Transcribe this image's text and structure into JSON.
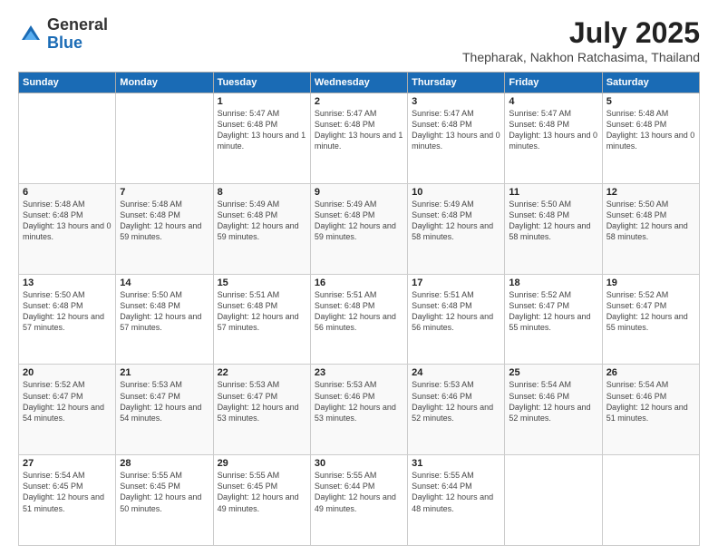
{
  "header": {
    "logo": {
      "general": "General",
      "blue": "Blue"
    },
    "title": "July 2025",
    "subtitle": "Thepharak, Nakhon Ratchasima, Thailand"
  },
  "days_of_week": [
    "Sunday",
    "Monday",
    "Tuesday",
    "Wednesday",
    "Thursday",
    "Friday",
    "Saturday"
  ],
  "weeks": [
    [
      {
        "day": "",
        "info": ""
      },
      {
        "day": "",
        "info": ""
      },
      {
        "day": "1",
        "info": "Sunrise: 5:47 AM\nSunset: 6:48 PM\nDaylight: 13 hours and 1 minute."
      },
      {
        "day": "2",
        "info": "Sunrise: 5:47 AM\nSunset: 6:48 PM\nDaylight: 13 hours and 1 minute."
      },
      {
        "day": "3",
        "info": "Sunrise: 5:47 AM\nSunset: 6:48 PM\nDaylight: 13 hours and 0 minutes."
      },
      {
        "day": "4",
        "info": "Sunrise: 5:47 AM\nSunset: 6:48 PM\nDaylight: 13 hours and 0 minutes."
      },
      {
        "day": "5",
        "info": "Sunrise: 5:48 AM\nSunset: 6:48 PM\nDaylight: 13 hours and 0 minutes."
      }
    ],
    [
      {
        "day": "6",
        "info": "Sunrise: 5:48 AM\nSunset: 6:48 PM\nDaylight: 13 hours and 0 minutes."
      },
      {
        "day": "7",
        "info": "Sunrise: 5:48 AM\nSunset: 6:48 PM\nDaylight: 12 hours and 59 minutes."
      },
      {
        "day": "8",
        "info": "Sunrise: 5:49 AM\nSunset: 6:48 PM\nDaylight: 12 hours and 59 minutes."
      },
      {
        "day": "9",
        "info": "Sunrise: 5:49 AM\nSunset: 6:48 PM\nDaylight: 12 hours and 59 minutes."
      },
      {
        "day": "10",
        "info": "Sunrise: 5:49 AM\nSunset: 6:48 PM\nDaylight: 12 hours and 58 minutes."
      },
      {
        "day": "11",
        "info": "Sunrise: 5:50 AM\nSunset: 6:48 PM\nDaylight: 12 hours and 58 minutes."
      },
      {
        "day": "12",
        "info": "Sunrise: 5:50 AM\nSunset: 6:48 PM\nDaylight: 12 hours and 58 minutes."
      }
    ],
    [
      {
        "day": "13",
        "info": "Sunrise: 5:50 AM\nSunset: 6:48 PM\nDaylight: 12 hours and 57 minutes."
      },
      {
        "day": "14",
        "info": "Sunrise: 5:50 AM\nSunset: 6:48 PM\nDaylight: 12 hours and 57 minutes."
      },
      {
        "day": "15",
        "info": "Sunrise: 5:51 AM\nSunset: 6:48 PM\nDaylight: 12 hours and 57 minutes."
      },
      {
        "day": "16",
        "info": "Sunrise: 5:51 AM\nSunset: 6:48 PM\nDaylight: 12 hours and 56 minutes."
      },
      {
        "day": "17",
        "info": "Sunrise: 5:51 AM\nSunset: 6:48 PM\nDaylight: 12 hours and 56 minutes."
      },
      {
        "day": "18",
        "info": "Sunrise: 5:52 AM\nSunset: 6:47 PM\nDaylight: 12 hours and 55 minutes."
      },
      {
        "day": "19",
        "info": "Sunrise: 5:52 AM\nSunset: 6:47 PM\nDaylight: 12 hours and 55 minutes."
      }
    ],
    [
      {
        "day": "20",
        "info": "Sunrise: 5:52 AM\nSunset: 6:47 PM\nDaylight: 12 hours and 54 minutes."
      },
      {
        "day": "21",
        "info": "Sunrise: 5:53 AM\nSunset: 6:47 PM\nDaylight: 12 hours and 54 minutes."
      },
      {
        "day": "22",
        "info": "Sunrise: 5:53 AM\nSunset: 6:47 PM\nDaylight: 12 hours and 53 minutes."
      },
      {
        "day": "23",
        "info": "Sunrise: 5:53 AM\nSunset: 6:46 PM\nDaylight: 12 hours and 53 minutes."
      },
      {
        "day": "24",
        "info": "Sunrise: 5:53 AM\nSunset: 6:46 PM\nDaylight: 12 hours and 52 minutes."
      },
      {
        "day": "25",
        "info": "Sunrise: 5:54 AM\nSunset: 6:46 PM\nDaylight: 12 hours and 52 minutes."
      },
      {
        "day": "26",
        "info": "Sunrise: 5:54 AM\nSunset: 6:46 PM\nDaylight: 12 hours and 51 minutes."
      }
    ],
    [
      {
        "day": "27",
        "info": "Sunrise: 5:54 AM\nSunset: 6:45 PM\nDaylight: 12 hours and 51 minutes."
      },
      {
        "day": "28",
        "info": "Sunrise: 5:55 AM\nSunset: 6:45 PM\nDaylight: 12 hours and 50 minutes."
      },
      {
        "day": "29",
        "info": "Sunrise: 5:55 AM\nSunset: 6:45 PM\nDaylight: 12 hours and 49 minutes."
      },
      {
        "day": "30",
        "info": "Sunrise: 5:55 AM\nSunset: 6:44 PM\nDaylight: 12 hours and 49 minutes."
      },
      {
        "day": "31",
        "info": "Sunrise: 5:55 AM\nSunset: 6:44 PM\nDaylight: 12 hours and 48 minutes."
      },
      {
        "day": "",
        "info": ""
      },
      {
        "day": "",
        "info": ""
      }
    ]
  ]
}
